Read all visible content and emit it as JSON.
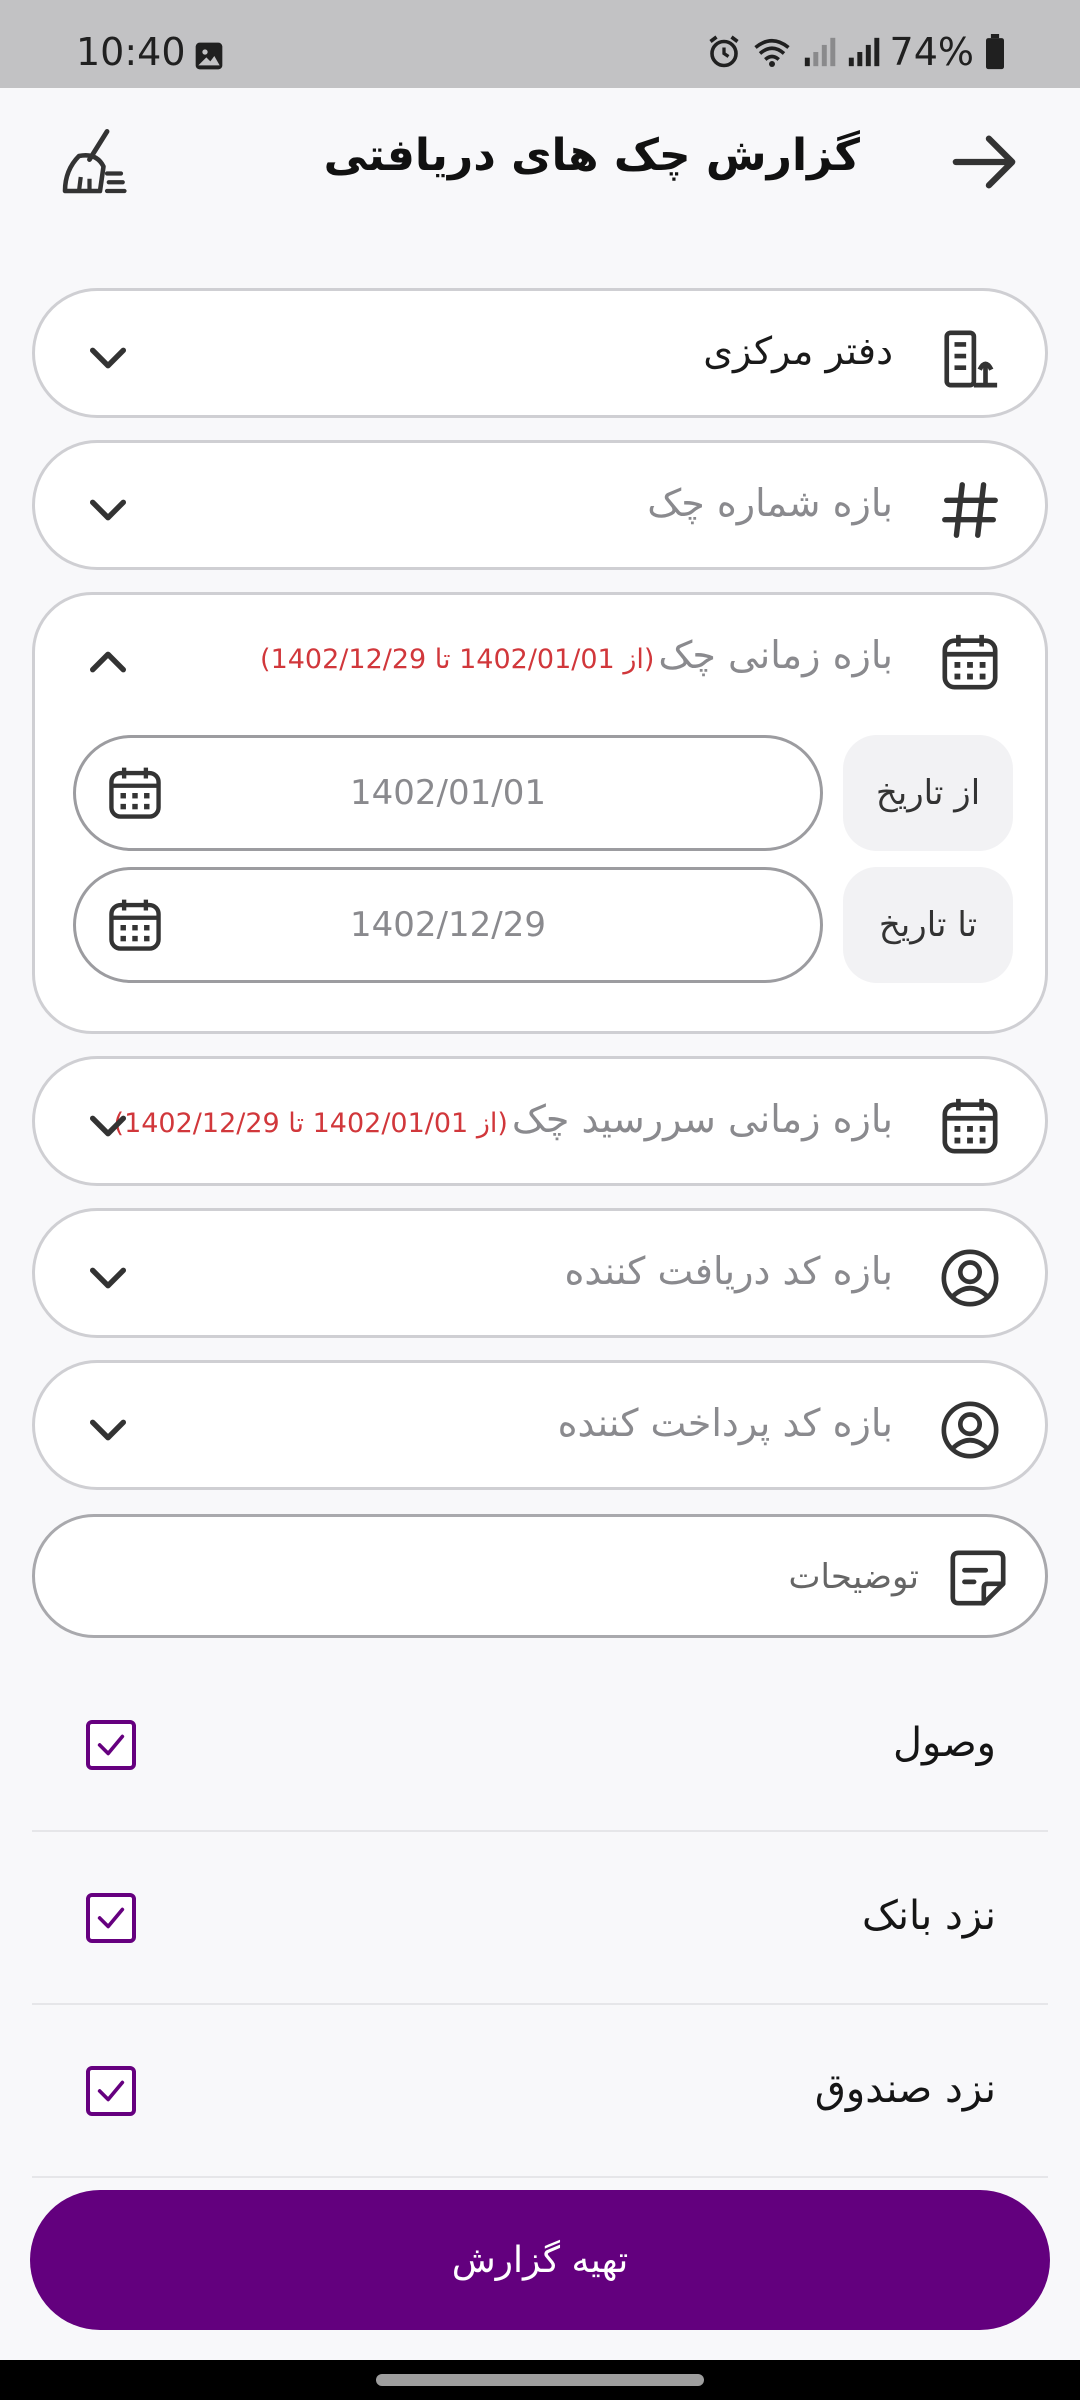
{
  "status_bar": {
    "time": "10:40",
    "battery": "74%"
  },
  "header": {
    "title": "گزارش چک های دریافتی"
  },
  "filters": {
    "branch": {
      "label": "دفتر مرکزی"
    },
    "check_number_range": {
      "label": "بازه شماره چک"
    },
    "check_date_range": {
      "label": "بازه زمانی چک",
      "note": "(از 1402/01/01 تا 1402/12/29)",
      "from_label": "از تاریخ",
      "from_value": "1402/01/01",
      "to_label": "تا تاریخ",
      "to_value": "1402/12/29"
    },
    "due_date_range": {
      "label": "بازه زمانی سررسید چک",
      "note": "(از 1402/01/01 تا 1402/12/29)"
    },
    "receiver_code_range": {
      "label": "بازه کد دریافت کننده"
    },
    "payer_code_range": {
      "label": "بازه کد پرداخت کننده"
    },
    "notes": {
      "placeholder": "توضیحات"
    }
  },
  "statuses": [
    {
      "label": "وصول",
      "checked": true
    },
    {
      "label": "نزد بانک",
      "checked": true
    },
    {
      "label": "نزد صندوق",
      "checked": true
    }
  ],
  "actions": {
    "submit_label": "تهیه گزارش"
  },
  "colors": {
    "accent": "#63007e",
    "note": "#d1373b"
  },
  "icons": [
    "back-arrow-icon",
    "broom-icon",
    "building-icon",
    "hash-icon",
    "calendar-icon",
    "user-circle-icon",
    "note-icon",
    "chevron-down-icon",
    "chevron-up-icon",
    "check-icon"
  ]
}
